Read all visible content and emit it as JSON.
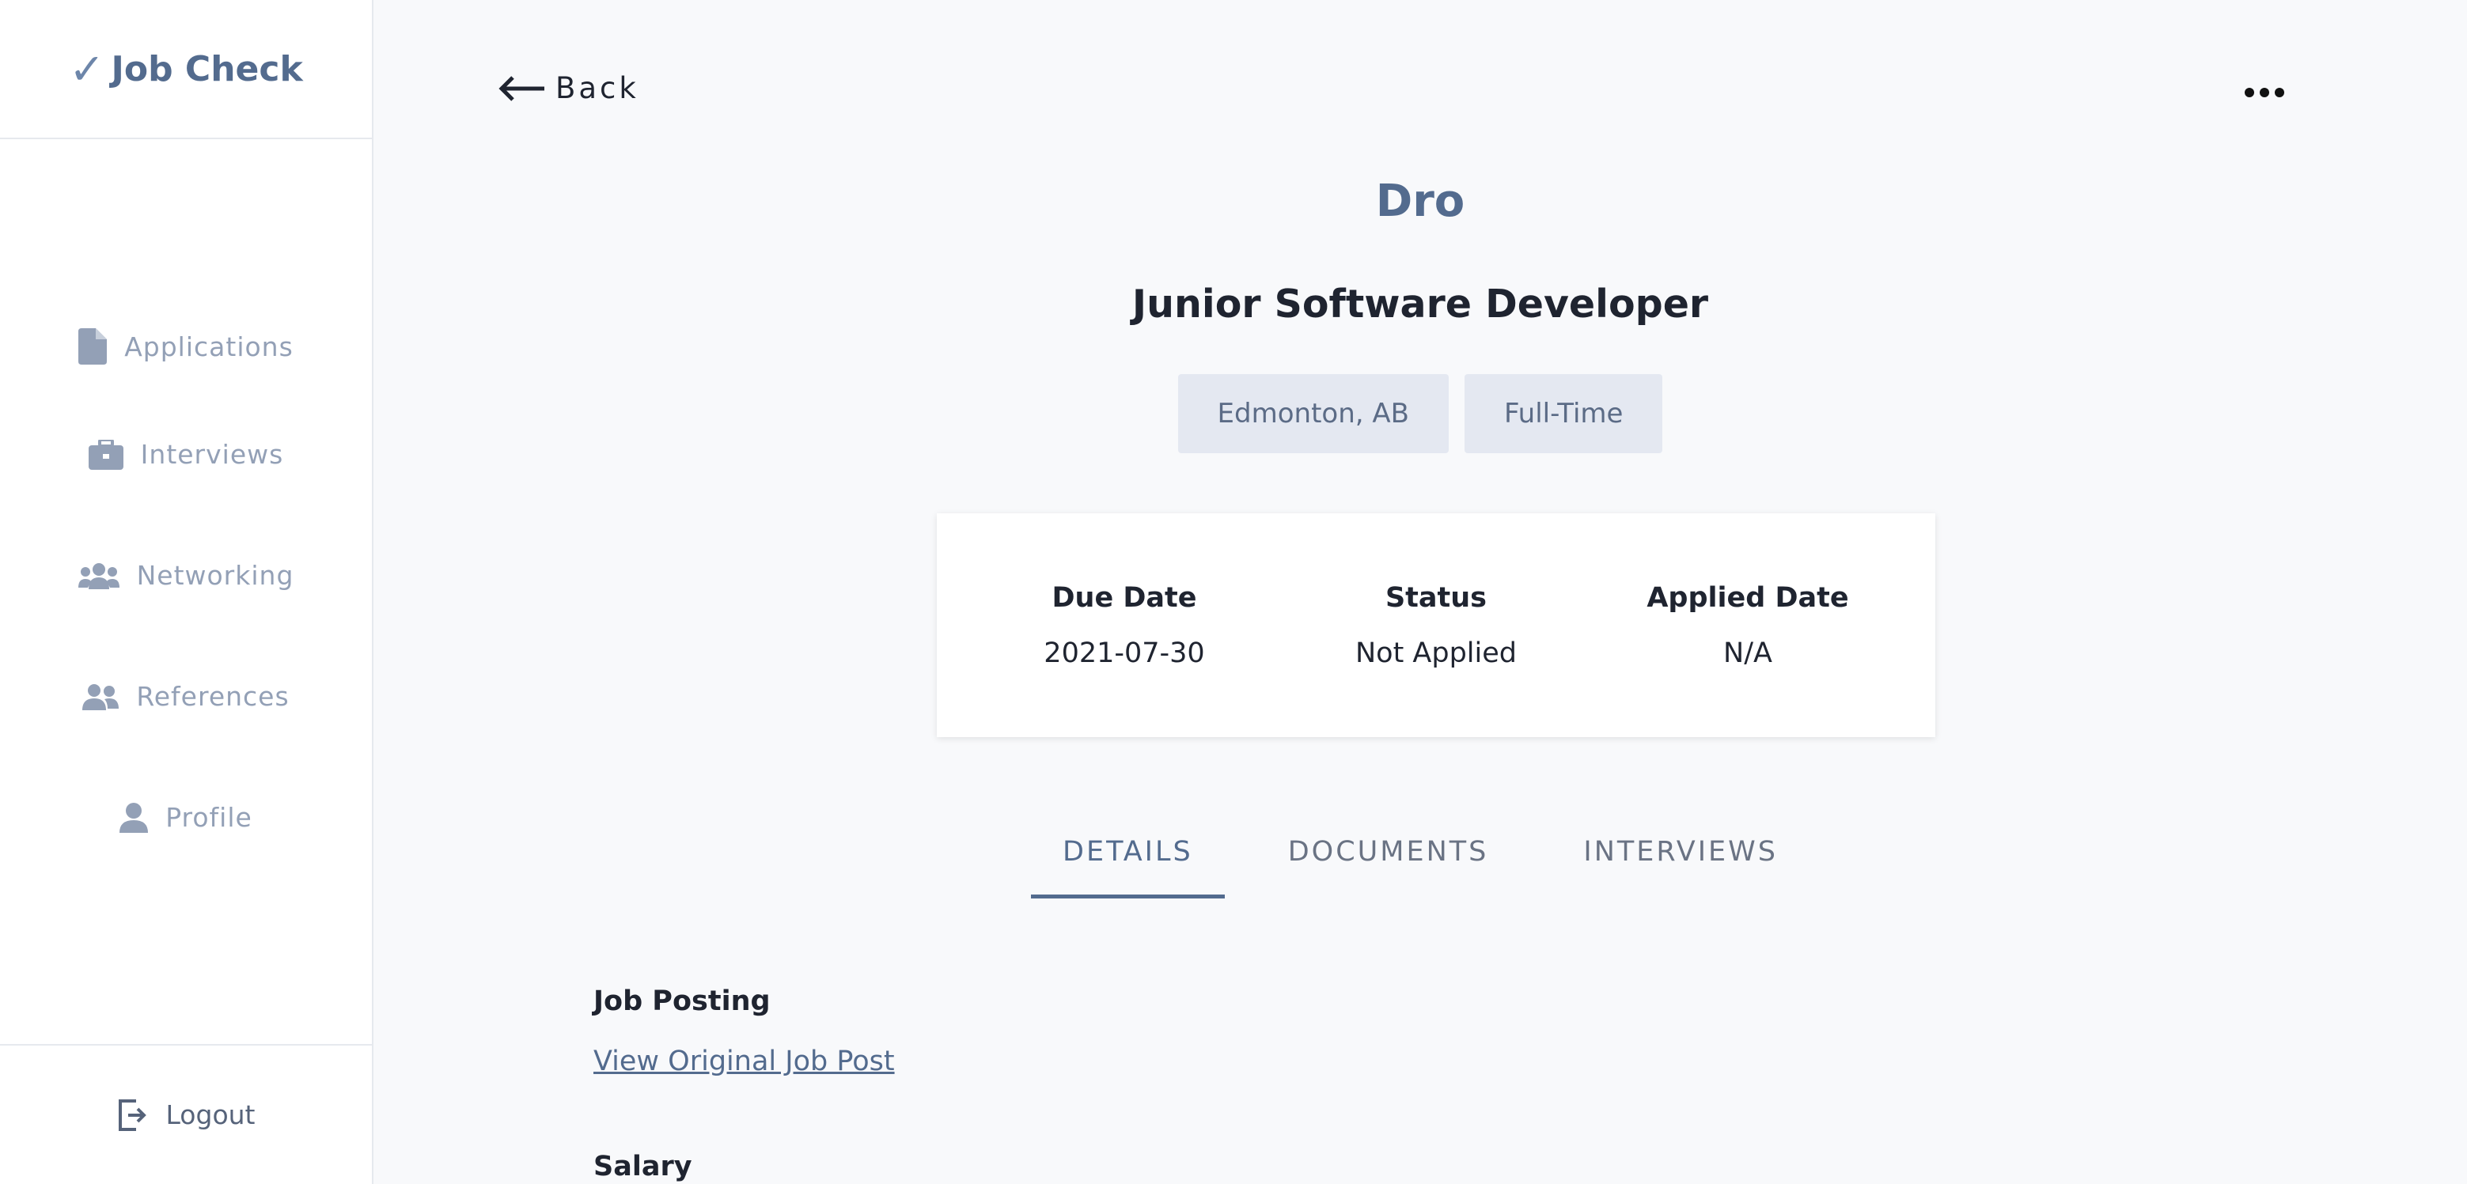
{
  "brand": {
    "check": "✓",
    "name": "Job Check"
  },
  "sidebar": {
    "items": [
      {
        "label": "Applications",
        "icon": "document-icon"
      },
      {
        "label": "Interviews",
        "icon": "briefcase-icon"
      },
      {
        "label": "Networking",
        "icon": "users-icon"
      },
      {
        "label": "References",
        "icon": "user-friends-icon"
      },
      {
        "label": "Profile",
        "icon": "user-icon"
      }
    ],
    "logout": "Logout"
  },
  "header": {
    "back_label": "Back"
  },
  "job": {
    "company": "Dro",
    "title": "Junior Software Developer",
    "tags": [
      "Edmonton, AB",
      "Full-Time"
    ]
  },
  "summary": {
    "due_date_label": "Due Date",
    "due_date_value": "2021-07-30",
    "status_label": "Status",
    "status_value": "Not Applied",
    "applied_date_label": "Applied Date",
    "applied_date_value": "N/A"
  },
  "tabs": [
    "DETAILS",
    "DOCUMENTS",
    "INTERVIEWS"
  ],
  "details": {
    "job_posting_label": "Job Posting",
    "job_post_link": "View Original Job Post",
    "salary_label": "Salary"
  },
  "colors": {
    "accent": "#536b8e",
    "muted": "#93a0b6",
    "tag_bg": "#e4e8f1"
  }
}
